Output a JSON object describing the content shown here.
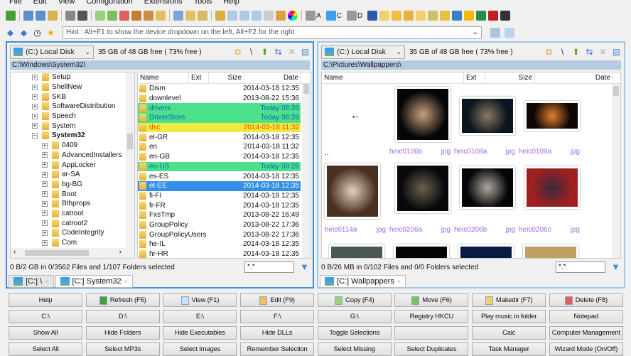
{
  "menu": [
    "File",
    "Edit",
    "View",
    "Configuration",
    "Extensions",
    "Tools",
    "Help"
  ],
  "toolbar": {
    "drive_labels": [
      "A",
      "C",
      "D"
    ]
  },
  "hint": "Hint : Alt+F1 to show the device dropdown on the left, Alt+F2 for the right",
  "colors": {
    "accent": "#3c8fd8",
    "new_row": "#4be08a",
    "new_text": "#1060c0",
    "mod_row": "#f0ea40",
    "mod_text": "#e05000",
    "selected": "#3390e8"
  },
  "left": {
    "drive": "(C:) Local Disk",
    "free": "35 GB of 48 GB free ( 73% free )",
    "path": "C:\\Windows\\System32\\",
    "tree": [
      {
        "label": "Setup",
        "level": 0
      },
      {
        "label": "ShellNew",
        "level": 0
      },
      {
        "label": "SKB",
        "level": 0
      },
      {
        "label": "SoftwareDistribution",
        "level": 0
      },
      {
        "label": "Speech",
        "level": 0
      },
      {
        "label": "System",
        "level": 0
      },
      {
        "label": "System32",
        "level": 0,
        "expanded": true
      },
      {
        "label": "0409",
        "level": 1
      },
      {
        "label": "AdvancedInstallers",
        "level": 1
      },
      {
        "label": "AppLocker",
        "level": 1
      },
      {
        "label": "ar-SA",
        "level": 1
      },
      {
        "label": "bg-BG",
        "level": 1
      },
      {
        "label": "Boot",
        "level": 1
      },
      {
        "label": "Bthprops",
        "level": 1
      },
      {
        "label": "catroot",
        "level": 1
      },
      {
        "label": "catroot2",
        "level": 1
      },
      {
        "label": "CodeIntegrity",
        "level": 1
      },
      {
        "label": "Com",
        "level": 1
      }
    ],
    "columns": {
      "name": "Name",
      "ext": "Ext",
      "size": "Size",
      "date": "Date"
    },
    "files": [
      {
        "name": "Dism",
        "date": "2014-03-18 12:35"
      },
      {
        "name": "downlevel",
        "date": "2013-08-22 15:36"
      },
      {
        "name": "drivers",
        "date": "Today 08:26",
        "state": "new"
      },
      {
        "name": "DriverStore",
        "date": "Today 08:26",
        "state": "new"
      },
      {
        "name": "dsc",
        "date": "2014-03-18 11:32",
        "state": "mod"
      },
      {
        "name": "el-GR",
        "date": "2014-03-18 12:35"
      },
      {
        "name": "en",
        "date": "2014-03-18 11:32"
      },
      {
        "name": "en-GB",
        "date": "2014-03-18 12:35"
      },
      {
        "name": "en-US",
        "date": "Today 08:26",
        "state": "new"
      },
      {
        "name": "es-ES",
        "date": "2014-03-18 12:35"
      },
      {
        "name": "et-EE",
        "date": "2014-03-18 12:35",
        "state": "sel"
      },
      {
        "name": "fi-FI",
        "date": "2014-03-18 12:35"
      },
      {
        "name": "fr-FR",
        "date": "2014-03-18 12:35"
      },
      {
        "name": "FxsTmp",
        "date": "2013-08-22 16:49"
      },
      {
        "name": "GroupPolicy",
        "date": "2013-08-22 17:36"
      },
      {
        "name": "GroupPolicyUsers",
        "date": "2013-08-22 17:36"
      },
      {
        "name": "he-IL",
        "date": "2014-03-18 12:35"
      },
      {
        "name": "hr-HR",
        "date": "2014-03-18 12:35"
      }
    ],
    "status": "0 B/2 GB in 0/3562 Files and 1/107 Folders selected",
    "filter": "*.*",
    "tabs": [
      "[C:] \\",
      "[C:] System32"
    ]
  },
  "right": {
    "drive": "(C:) Local Disk",
    "free": "35 GB of 48 GB free ( 73% free )",
    "path": "C:\\Pictures\\Wallpappers\\",
    "columns": {
      "name": "Name",
      "ext": "Ext",
      "size": "Size",
      "date": "Date"
    },
    "up_label": "..",
    "thumbs": [
      {
        "name": "heic0106b",
        "ext": "jpg",
        "c1": "#c9a07a",
        "c2": "#050508"
      },
      {
        "name": "heic0108a",
        "ext": "jpg",
        "c1": "#8a7a60",
        "c2": "#0a1520"
      },
      {
        "name": "heic0109a",
        "ext": "jpg",
        "c1": "#e08030",
        "c2": "#100604"
      },
      {
        "name": "heic0114a",
        "ext": "jpg",
        "c1": "#e0d0c0",
        "c2": "#4a3020"
      },
      {
        "name": "heic0206a",
        "ext": "jpg",
        "c1": "#6a6050",
        "c2": "#08080a"
      },
      {
        "name": "heic0206b",
        "ext": "jpg",
        "c1": "#b0a8a0",
        "c2": "#060608"
      },
      {
        "name": "heic0206c",
        "ext": "jpg",
        "c1": "#3a2a40",
        "c2": "#a02020"
      }
    ],
    "status": "0 B/26 MB in 0/102 Files and 0/0 Folders selected",
    "filter": "*.*",
    "tabs": [
      "[C:] Wallpappers"
    ]
  },
  "buttons": [
    "Help",
    "Refresh (F5)",
    "View (F1)",
    "Edit (F9)",
    "Copy (F4)",
    "Move (F6)",
    "Makedir (F7)",
    "Delete (F8)",
    "C:\\",
    "D:\\",
    "E:\\",
    "F:\\",
    "G:\\",
    "Registry HKCU",
    "Play music in folder",
    "Notepad",
    "Show All",
    "Hide Folders",
    "Hide Executables",
    "Hide DLLs",
    "Toggle Selections",
    "",
    "Calc",
    "Computer Management",
    "Select All",
    "Select MP3s",
    "Select Images",
    "Remember Selection",
    "Select Missing",
    "Select Duplicates",
    "Task Manager",
    "Wizard Mode (On/Off)"
  ]
}
